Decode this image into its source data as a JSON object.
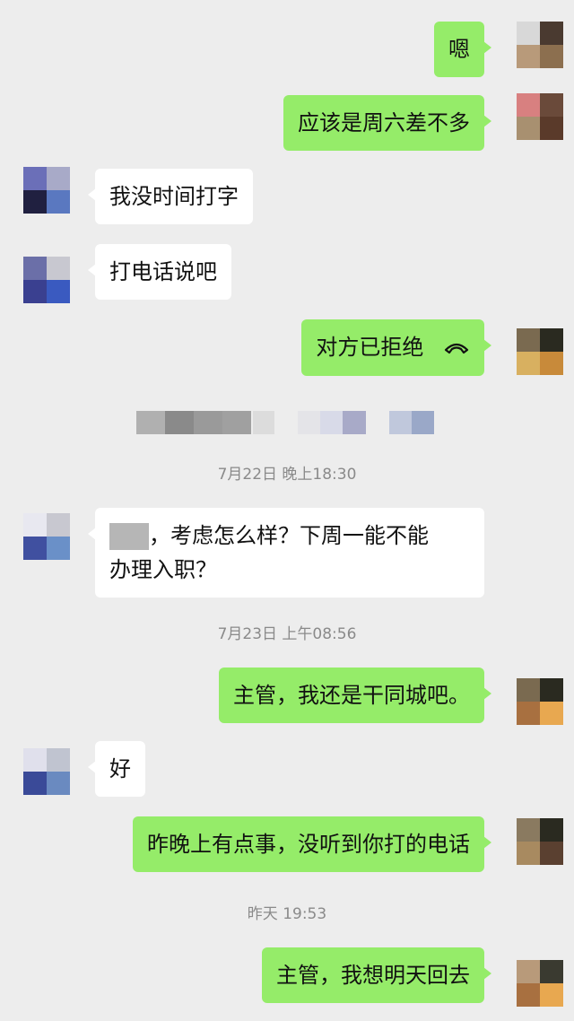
{
  "messages": {
    "m1": "嗯",
    "m2": "应该是周六差不多",
    "m3": "我没时间打字",
    "m4": "打电话说吧",
    "m5": "对方已拒绝",
    "m6_part1": "，考虑怎么样？下周一能不能",
    "m6_part2": "办理入职？",
    "m7": "主管，我还是干同城吧。",
    "m8": "好",
    "m9": "昨晚上有点事，没听到你打的电话",
    "m10": "主管，我想明天回去"
  },
  "timestamps": {
    "t1": "7月22日 晚上18:30",
    "t2": "7月23日 上午08:56",
    "t3": "昨天 19:53"
  },
  "icons": {
    "call_declined": "phone-hangup-icon"
  },
  "colors": {
    "background": "#ededed",
    "sent_bubble": "#95ec69",
    "received_bubble": "#ffffff",
    "timestamp_text": "#8a8a8a"
  }
}
